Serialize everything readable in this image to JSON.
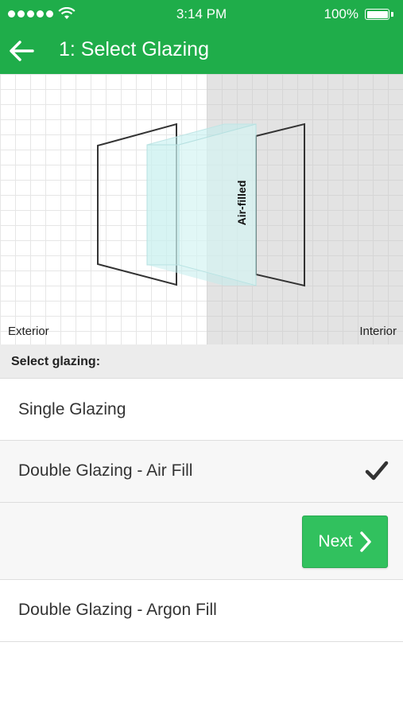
{
  "status_bar": {
    "time": "3:14 PM",
    "battery": "100%",
    "signal_icon": "signal-dots-icon",
    "wifi_icon": "wifi-icon",
    "battery_icon": "battery-icon"
  },
  "header": {
    "title": "1: Select Glazing",
    "back_icon": "back-arrow-icon",
    "color": "#1fad4a"
  },
  "diagram": {
    "exterior_label": "Exterior",
    "interior_label": "Interior",
    "gap_label": "Air-filled"
  },
  "section": {
    "title": "Select glazing:"
  },
  "options": [
    {
      "label": "Single Glazing",
      "selected": false
    },
    {
      "label": "Double Glazing - Air Fill",
      "selected": true
    },
    {
      "label": "Double Glazing - Argon Fill",
      "selected": false
    }
  ],
  "next_button": {
    "label": "Next",
    "icon": "chevron-right-icon",
    "color": "#31c15e"
  }
}
